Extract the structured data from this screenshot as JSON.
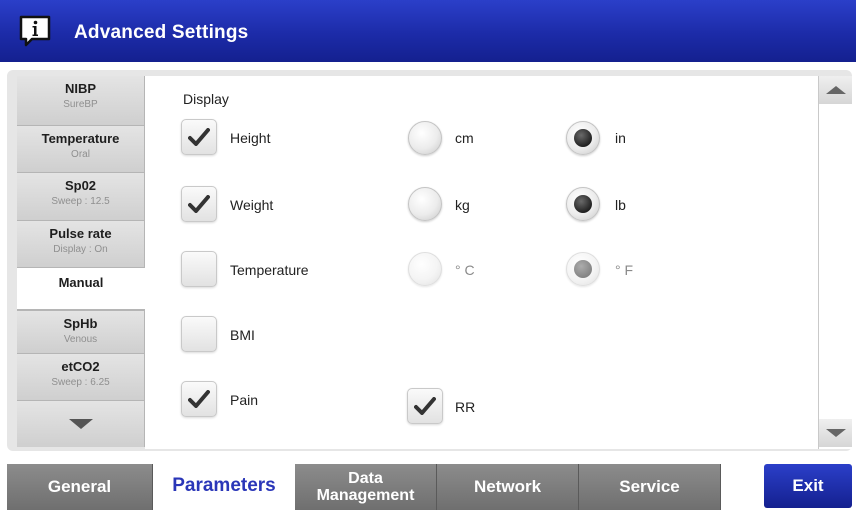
{
  "header": {
    "title": "Advanced Settings",
    "icon": "info-icon"
  },
  "sidebar": {
    "items": [
      {
        "title": "NIBP",
        "sub": "SureBP"
      },
      {
        "title": "Temperature",
        "sub": "Oral"
      },
      {
        "title": "Sp02",
        "sub": "Sweep : 12.5"
      },
      {
        "title": "Pulse rate",
        "sub": "Display : On"
      },
      {
        "title": "Manual",
        "sub": ""
      },
      {
        "title": "SpHb",
        "sub": "Venous"
      },
      {
        "title": "etCO2",
        "sub": "Sweep : 6.25"
      }
    ],
    "active_index": 4,
    "scroll_down_icon": "chevron-down-icon"
  },
  "main": {
    "section_label": "Display",
    "rows": [
      {
        "label": "Height",
        "checked": true,
        "unit_a": "cm",
        "unit_b": "in",
        "selected": "in"
      },
      {
        "label": "Weight",
        "checked": true,
        "unit_a": "kg",
        "unit_b": "lb",
        "selected": "lb"
      },
      {
        "label": "Temperature",
        "checked": false,
        "unit_a": "° C",
        "unit_b": "° F",
        "selected": "° F"
      },
      {
        "label": "BMI",
        "checked": false
      },
      {
        "label": "Pain",
        "checked": true
      }
    ],
    "extra_checkbox": {
      "label": "RR",
      "checked": true
    }
  },
  "tabs": [
    {
      "label": "General"
    },
    {
      "label": "Parameters"
    },
    {
      "label_line1": "Data",
      "label_line2": "Management"
    },
    {
      "label": "Network"
    },
    {
      "label": "Service"
    }
  ],
  "active_tab": "Parameters",
  "exit_label": "Exit",
  "colors": {
    "header_blue": "#1c2ba8",
    "active_tab_text": "#2a36b8",
    "tab_gray": "#7d7d7d"
  }
}
